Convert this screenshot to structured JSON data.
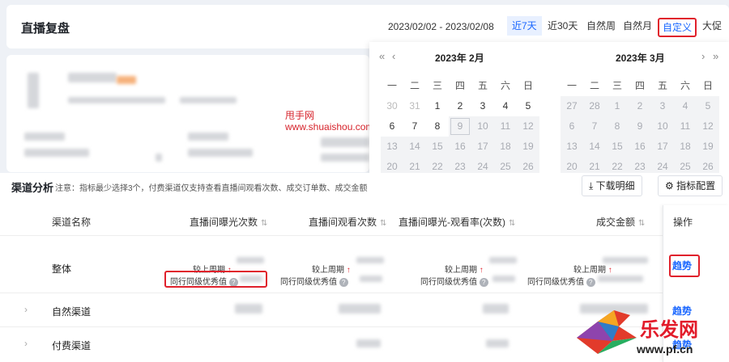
{
  "header": {
    "title": "直播复盘",
    "date_range": "2023/02/02 - 2023/02/08",
    "quick_options": [
      "近7天",
      "近30天",
      "自然周",
      "自然月",
      "自定义",
      "大促"
    ]
  },
  "watermark": {
    "line1": "甩手网",
    "line2": "www.shuaishou.com"
  },
  "calendar": {
    "weekdays": [
      "一",
      "二",
      "三",
      "四",
      "五",
      "六",
      "日"
    ],
    "left": {
      "title": "2023年  2月",
      "rows": [
        [
          "30",
          "31",
          "1",
          "2",
          "3",
          "4",
          "5"
        ],
        [
          "6",
          "7",
          "8",
          "9",
          "10",
          "11",
          "12"
        ],
        [
          "13",
          "14",
          "15",
          "16",
          "17",
          "18",
          "19"
        ],
        [
          "20",
          "21",
          "22",
          "23",
          "24",
          "25",
          "26"
        ]
      ]
    },
    "right": {
      "title": "2023年  3月",
      "rows": [
        [
          "27",
          "28",
          "1",
          "2",
          "3",
          "4",
          "5"
        ],
        [
          "6",
          "7",
          "8",
          "9",
          "10",
          "11",
          "12"
        ],
        [
          "13",
          "14",
          "15",
          "16",
          "17",
          "18",
          "19"
        ],
        [
          "20",
          "21",
          "22",
          "23",
          "24",
          "25",
          "26"
        ]
      ]
    }
  },
  "channel": {
    "title": "渠道分析",
    "note": "注意：指标最少选择3个，付费渠道仅支持查看直播间观看次数、成交订单数、成交金额",
    "download_label": "下载明细",
    "config_label": "指标配置",
    "columns": {
      "name": "渠道名称",
      "exposure": "直播间曝光次数",
      "views": "直播间观看次数",
      "rate": "直播间曝光-观看率(次数)",
      "gmv": "成交金额",
      "op": "操作"
    },
    "rows": [
      {
        "name": "整体",
        "trend": "趋势"
      },
      {
        "name": "自然渠道",
        "trend": "趋势"
      },
      {
        "name": "付费渠道",
        "trend": "趋势"
      }
    ],
    "compare_label": "较上周期",
    "peer_label": "同行同级优秀值"
  },
  "logo": {
    "text": "乐发网",
    "url": "www.pf.cn"
  }
}
